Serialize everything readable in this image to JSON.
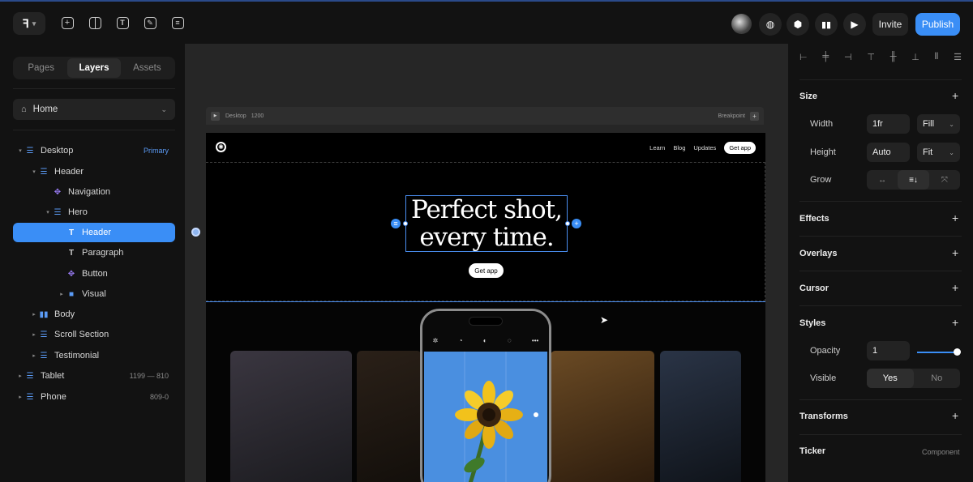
{
  "toolbar": {
    "logo_icon": "framer-logo-icon",
    "tools": [
      "plus-icon",
      "layout-icon",
      "text-icon",
      "pen-icon",
      "cms-icon"
    ],
    "right_icons": [
      "globe-icon",
      "settings-hex-icon",
      "analytics-icon",
      "play-icon"
    ],
    "invite_label": "Invite",
    "publish_label": "Publish",
    "accent": "#3a8ef6"
  },
  "left": {
    "tabs": [
      "Pages",
      "Layers",
      "Assets"
    ],
    "active_tab": "Layers",
    "page_select": "Home",
    "layers": [
      {
        "label": "Desktop",
        "meta": "Primary"
      },
      {
        "label": "Header",
        "meta": ""
      },
      {
        "label": "Navigation",
        "meta": ""
      },
      {
        "label": "Hero",
        "meta": ""
      },
      {
        "label": "Header",
        "meta": ""
      },
      {
        "label": "Paragraph",
        "meta": ""
      },
      {
        "label": "Button",
        "meta": ""
      },
      {
        "label": "Visual",
        "meta": ""
      },
      {
        "label": "Body",
        "meta": ""
      },
      {
        "label": "Scroll Section",
        "meta": ""
      },
      {
        "label": "Testimonial",
        "meta": ""
      },
      {
        "label": "Tablet",
        "meta": "1199 — 810"
      },
      {
        "label": "Phone",
        "meta": "809-0"
      }
    ]
  },
  "canvas": {
    "frame_name": "Desktop",
    "frame_width": "1200",
    "breakpoint_label": "Breakpoint",
    "nav": [
      "Learn",
      "Blog",
      "Updates"
    ],
    "nav_cta": "Get app",
    "hero_line1": "Perfect shot,",
    "hero_line2": "every time.",
    "hero_button": "Get app"
  },
  "right": {
    "size_title": "Size",
    "width_label": "Width",
    "width_value": "1fr",
    "width_mode": "Fill",
    "height_label": "Height",
    "height_value": "Auto",
    "height_mode": "Fit",
    "grow_label": "Grow",
    "effects_title": "Effects",
    "overlays_title": "Overlays",
    "cursor_title": "Cursor",
    "styles_title": "Styles",
    "opacity_label": "Opacity",
    "opacity_value": "1",
    "visible_label": "Visible",
    "visible_yes": "Yes",
    "visible_no": "No",
    "transforms_title": "Transforms",
    "ticker_title": "Ticker",
    "ticker_tag": "Component"
  }
}
